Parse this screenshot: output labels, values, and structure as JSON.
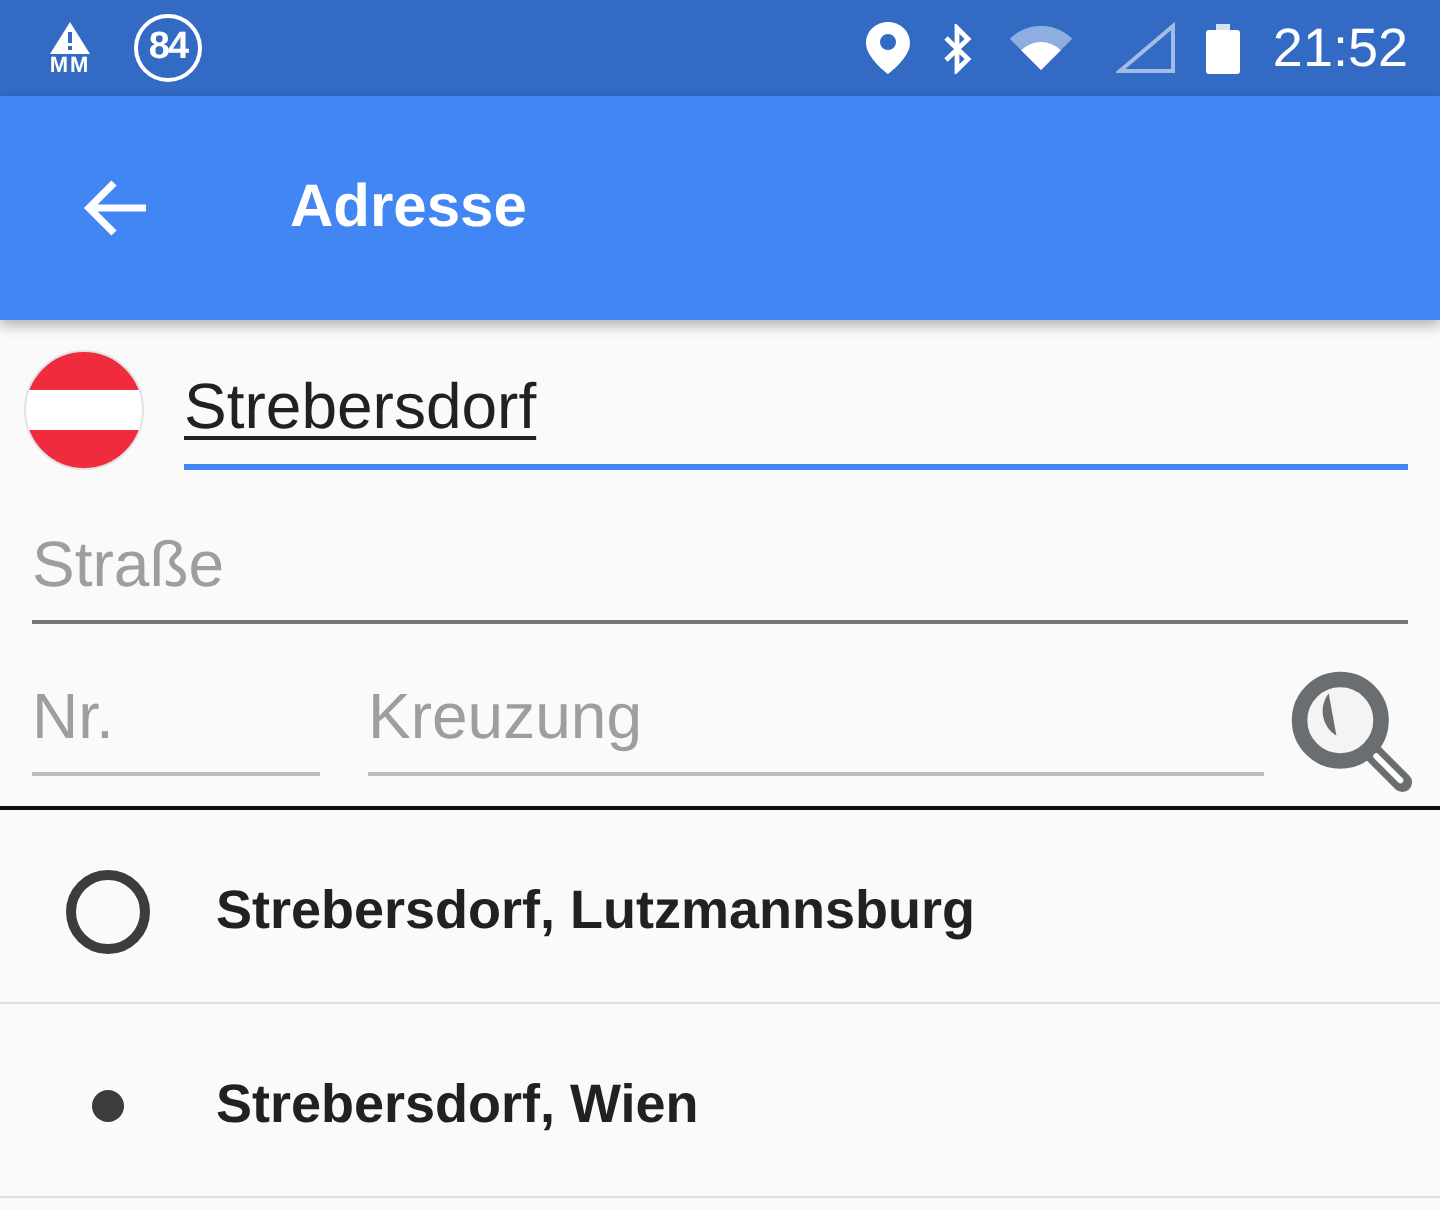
{
  "status_bar": {
    "warning_label": "MM",
    "badge": "84",
    "time": "21:52"
  },
  "app_bar": {
    "title": "Adresse"
  },
  "form": {
    "place": {
      "value": "Strebersdorf",
      "focused": true,
      "disabled": false,
      "composing": true
    },
    "street": {
      "placeholder": "Straße",
      "focused": false,
      "disabled": false
    },
    "number": {
      "placeholder": "Nr.",
      "focused": false,
      "disabled": true
    },
    "crossing": {
      "placeholder": "Kreuzung",
      "focused": false,
      "disabled": true
    }
  },
  "results": [
    {
      "label": "Strebersdorf, Lutzmannsburg",
      "kind": "ring"
    },
    {
      "label": "Strebersdorf, Wien",
      "kind": "dot"
    }
  ]
}
